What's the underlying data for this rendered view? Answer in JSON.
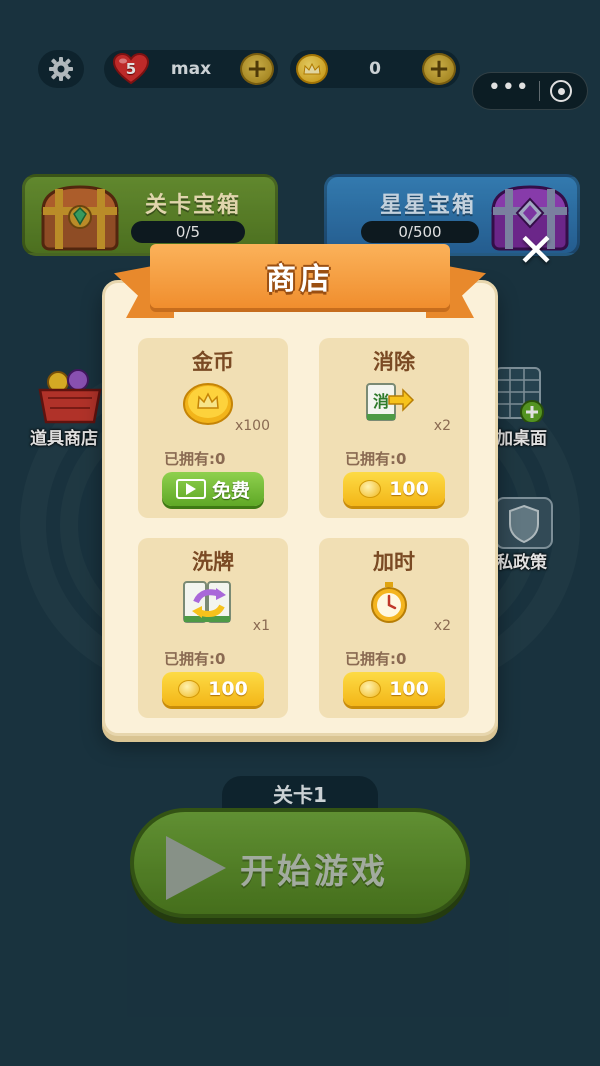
{
  "topbar": {
    "settings_icon": "gear-icon",
    "hearts_count": "5",
    "hearts_status": "max",
    "coins_value": "0"
  },
  "chests": {
    "level_chest_title": "关卡宝箱",
    "level_chest_progress": "0/5",
    "star_chest_title": "星星宝箱",
    "star_chest_progress": "0/500"
  },
  "side_items": {
    "item_shop_label": "道具商店",
    "add_desktop_label": "加桌面",
    "privacy_label": "私政策"
  },
  "shop": {
    "title": "商店",
    "items": [
      {
        "name": "金币",
        "qty": "x100",
        "owned_label": "已拥有:",
        "owned_value": "0",
        "button_label": "免费",
        "button_type": "free-video"
      },
      {
        "name": "消除",
        "qty": "x2",
        "owned_label": "已拥有:",
        "owned_value": "0",
        "button_label": "100",
        "button_type": "coin"
      },
      {
        "name": "洗牌",
        "qty": "x1",
        "owned_label": "已拥有:",
        "owned_value": "0",
        "button_label": "100",
        "button_type": "coin"
      },
      {
        "name": "加时",
        "qty": "x2",
        "owned_label": "已拥有:",
        "owned_value": "0",
        "button_label": "100",
        "button_type": "coin"
      }
    ],
    "tile_char": "消"
  },
  "bottom": {
    "level_label": "关卡1",
    "start_label": "开始游戏"
  },
  "colors": {
    "background": "#1d3a47",
    "panel": "#fbf1d9",
    "card": "#f1dfb4",
    "ribbon": "#f08e2e",
    "coin_button": "#fddb45",
    "free_button": "#5fa826"
  }
}
